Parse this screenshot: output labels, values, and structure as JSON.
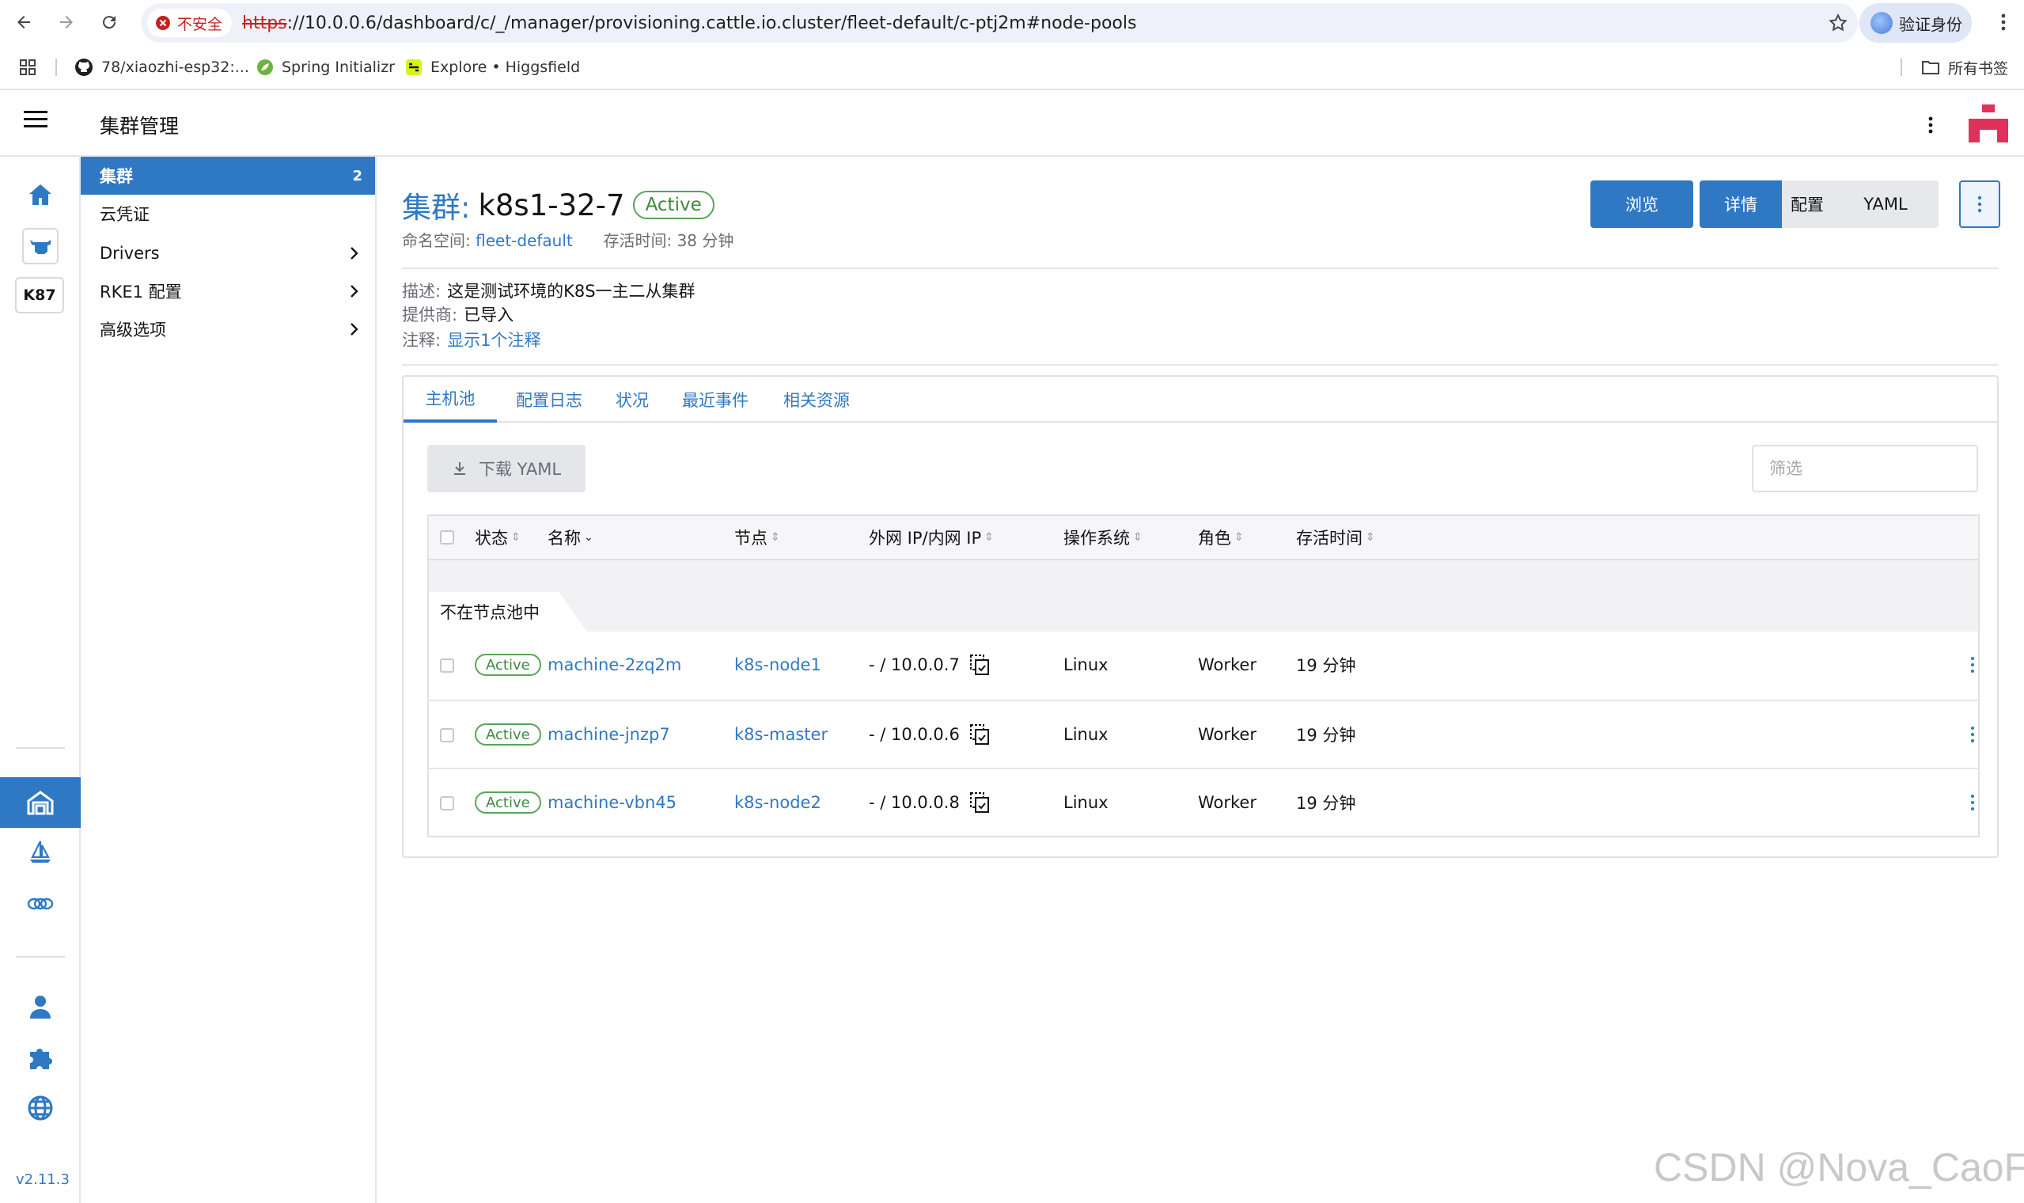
{
  "browser": {
    "insecure_label": "不安全",
    "url_scheme": "https",
    "url_rest": "://10.0.0.6/dashboard/c/_/manager/provisioning.cattle.io.cluster/fleet-default/c-ptj2m#node-pools",
    "verify_label": "验证身份",
    "bookmarks": [
      {
        "label": "78/xiaozhi-esp32:..."
      },
      {
        "label": "Spring Initializr"
      },
      {
        "label": "Explore • Higgsfield"
      }
    ],
    "all_bookmarks": "所有书签"
  },
  "app": {
    "title": "集群管理",
    "version": "v2.11.3",
    "rail_k87": "K87"
  },
  "sidenav": {
    "items": [
      {
        "label": "集群",
        "count": "2"
      },
      {
        "label": "云凭证"
      },
      {
        "label": "Drivers"
      },
      {
        "label": "RKE1 配置"
      },
      {
        "label": "高级选项"
      }
    ]
  },
  "cluster": {
    "title_label": "集群:",
    "name": "k8s1-32-7",
    "status": "Active",
    "namespace_label": "命名空间:",
    "namespace": "fleet-default",
    "age_label": "存活时间:",
    "age": "38 分钟",
    "description_label": "描述:",
    "description": "这是测试环境的K8S一主二从集群",
    "provider_label": "提供商:",
    "provider": "已导入",
    "annotation_label": "注释:",
    "annotation_link": "显示1个注释"
  },
  "actions": {
    "browse": "浏览",
    "detail": "详情",
    "config": "配置",
    "yaml": "YAML"
  },
  "tabs": [
    {
      "label": "主机池"
    },
    {
      "label": "配置日志"
    },
    {
      "label": "状况"
    },
    {
      "label": "最近事件"
    },
    {
      "label": "相关资源"
    }
  ],
  "toolbar": {
    "download_yaml": "下载 YAML",
    "filter_placeholder": "筛选"
  },
  "table": {
    "columns": [
      "状态",
      "名称",
      "节点",
      "外网 IP/内网 IP",
      "操作系统",
      "角色",
      "存活时间"
    ],
    "group_label": "不在节点池中",
    "rows": [
      {
        "status": "Active",
        "name": "machine-2zq2m",
        "node": "k8s-node1",
        "ip": "- / 10.0.0.7",
        "os": "Linux",
        "role": "Worker",
        "age": "19 分钟"
      },
      {
        "status": "Active",
        "name": "machine-jnzp7",
        "node": "k8s-master",
        "ip": "- / 10.0.0.6",
        "os": "Linux",
        "role": "Worker",
        "age": "19 分钟"
      },
      {
        "status": "Active",
        "name": "machine-vbn45",
        "node": "k8s-node2",
        "ip": "- / 10.0.0.8",
        "os": "Linux",
        "role": "Worker",
        "age": "19 分钟"
      }
    ]
  },
  "watermark": "CSDN @Nova_CaoFc",
  "colors": {
    "accent": "#2f78c4",
    "active_green": "#3d8a3d",
    "insecure_red": "#c5221f"
  }
}
